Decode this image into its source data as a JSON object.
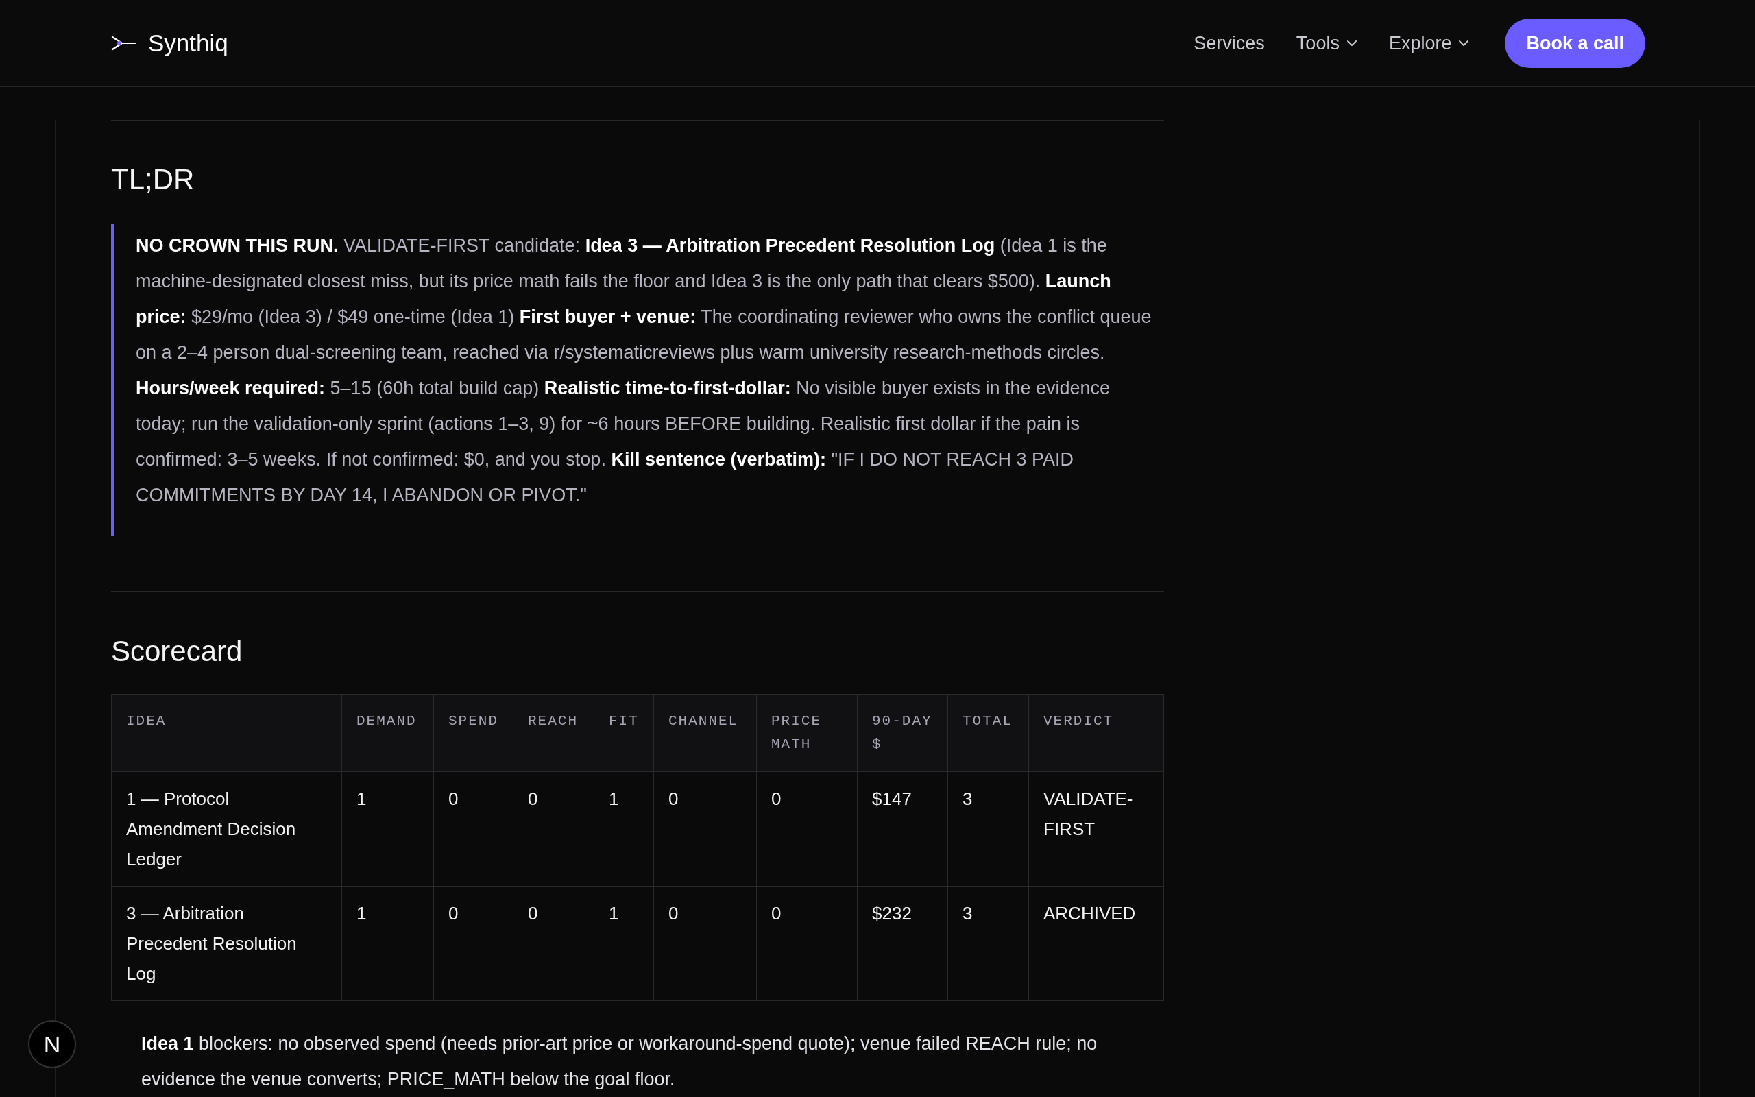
{
  "header": {
    "brand": "Synthiq",
    "nav": [
      {
        "label": "Services",
        "kind": "link"
      },
      {
        "label": "Tools",
        "kind": "menu"
      },
      {
        "label": "Explore",
        "kind": "menu"
      }
    ],
    "cta": "Book a call"
  },
  "tldr": {
    "heading": "TL;DR",
    "summary": "**NO CROWN THIS RUN.** VALIDATE-FIRST candidate: **Idea 3 — Arbitration Precedent Resolution Log** (Idea 1 is the machine-designated closest miss, but its price math fails the floor and Idea 3 is the only path that clears $500). **Launch price:** $29/mo (Idea 3) / $49 one-time (Idea 1) **First buyer + venue:** The coordinating reviewer who owns the conflict queue on a 2–4 person dual-screening team, reached via r/systematicreviews plus warm university research-methods circles. **Hours/week required:** 5–15 (60h total build cap) **Realistic time-to-first-dollar:** No visible buyer exists in the evidence today; run the validation-only sprint (actions 1–3, 9) for ~6 hours BEFORE building. Realistic first dollar if the pain is confirmed: 3–5 weeks. If not confirmed: $0, and you stop. **Kill sentence (verbatim):** \"IF I DO NOT REACH 3 PAID COMMITMENTS BY DAY 14, I ABANDON OR PIVOT.\""
  },
  "scorecard": {
    "heading": "Scorecard",
    "table": {
      "columns": [
        "IDEA",
        "DEMAND",
        "SPEND",
        "REACH",
        "FIT",
        "CHANNEL",
        "PRICE MATH",
        "90-DAY $",
        "TOTAL",
        "VERDICT"
      ],
      "rows": [
        [
          "1 — Protocol Amendment Decision Ledger",
          "1",
          "0",
          "0",
          "1",
          "0",
          "0",
          "$147",
          "3",
          "VALIDATE-FIRST"
        ],
        [
          "3 — Arbitration Precedent Resolution Log",
          "1",
          "0",
          "0",
          "1",
          "0",
          "0",
          "$232",
          "3",
          "ARCHIVED"
        ]
      ]
    },
    "notes": [
      "**Idea 1** blockers: no observed spend (needs prior-art price or workaround-spend quote); venue failed REACH rule; no evidence the venue converts; PRICE_MATH below the goal floor."
    ]
  },
  "dev_indicator": {
    "label": "N"
  }
}
